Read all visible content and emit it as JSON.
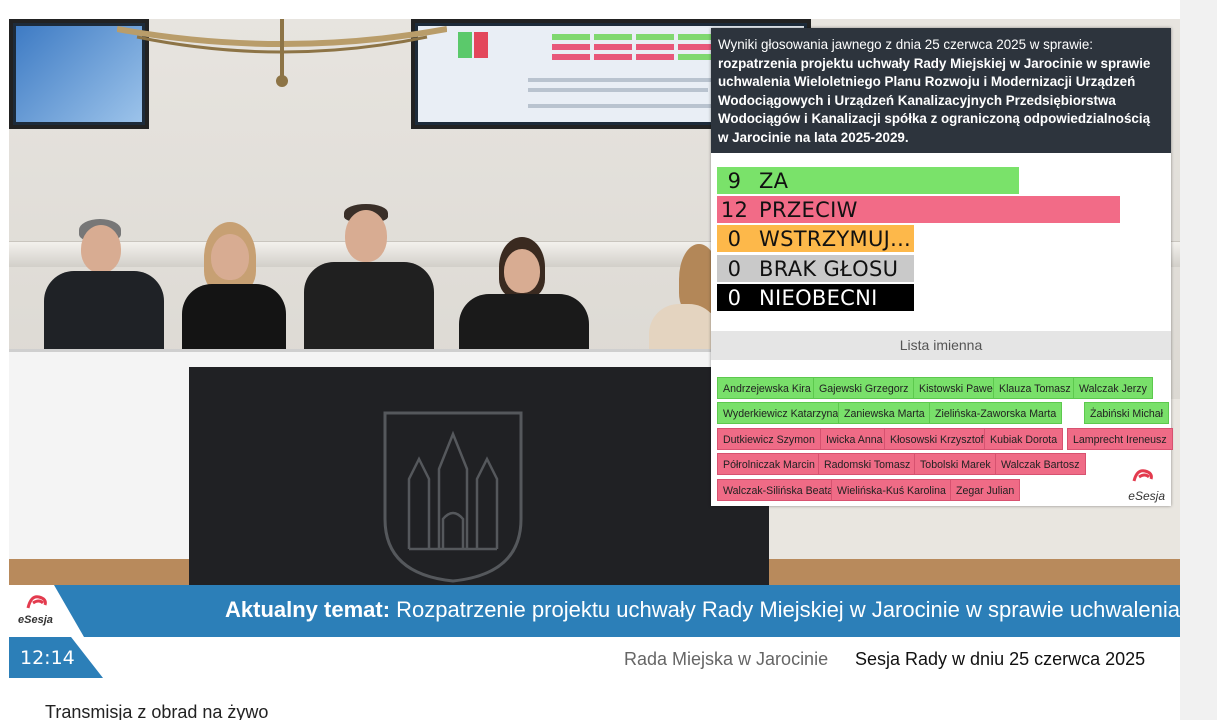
{
  "vote_panel": {
    "intro": "Wyniki głosowania jawnego z dnia 25 czerwca 2025 w sprawie:",
    "subject": "rozpatrzenia projektu uchwały Rady Miejskiej w Jarocinie w sprawie uchwalenia Wieloletniego Planu Rozwoju i Modernizacji Urządzeń Wodociągowych i Urządzeń Kanalizacyjnych Przedsiębiorstwa Wodociągów i Kanalizacji spółka z ograniczoną odpowiedzialnością w Jarocinie na lata 2025-2029.",
    "results": [
      {
        "count": "9",
        "label": "ZA",
        "color": "#7ae26a",
        "share": 0.75
      },
      {
        "count": "12",
        "label": "PRZECIW",
        "color": "#f26b87",
        "share": 1.0
      },
      {
        "count": "0",
        "label": "WSTRZYMUJ...",
        "color": "#fdb84a",
        "share": 0.49
      },
      {
        "count": "0",
        "label": "BRAK GŁOSU",
        "color": "#c9c9c9",
        "share": 0.49
      },
      {
        "count": "0",
        "label": "NIEOBECNI",
        "color": "#000000",
        "share": 0.49
      }
    ],
    "list_header": "Lista imienna",
    "names": [
      {
        "name": "Andrzejewska Kira",
        "vote": "for"
      },
      {
        "name": "Gajewski Grzegorz",
        "vote": "for"
      },
      {
        "name": "Kistowski Paweł",
        "vote": "for"
      },
      {
        "name": "Klauza Tomasz",
        "vote": "for"
      },
      {
        "name": "Walczak Jerzy",
        "vote": "for"
      },
      {
        "name": "Wyderkiewicz Katarzyna",
        "vote": "for"
      },
      {
        "name": "Zaniewska Marta",
        "vote": "for"
      },
      {
        "name": "Zielińska-Zaworska Marta",
        "vote": "for"
      },
      {
        "name": "Żabiński Michał",
        "vote": "for"
      },
      {
        "name": "Dutkiewicz Szymon",
        "vote": "against"
      },
      {
        "name": "Iwicka Anna",
        "vote": "against"
      },
      {
        "name": "Kłosowski Krzysztof",
        "vote": "against"
      },
      {
        "name": "Kubiak Dorota",
        "vote": "against"
      },
      {
        "name": "Lamprecht Ireneusz",
        "vote": "against"
      },
      {
        "name": "Półrolniczak Marcin",
        "vote": "against"
      },
      {
        "name": "Radomski Tomasz",
        "vote": "against"
      },
      {
        "name": "Tobolski Marek",
        "vote": "against"
      },
      {
        "name": "Walczak Bartosz",
        "vote": "against"
      },
      {
        "name": "Walczak-Silińska Beata",
        "vote": "against"
      },
      {
        "name": "Wielińska-Kuś Karolina",
        "vote": "against"
      },
      {
        "name": "Zegar Julian",
        "vote": "against"
      }
    ],
    "logo_text": "eSesja"
  },
  "topic_bar": {
    "key": "Aktualny temat:",
    "text": " Rozpatrzenie projektu uchwały Rady Miejskiej w Jarocinie w sprawie uchwalenia",
    "logo_text": "eSesja"
  },
  "footer": {
    "time": "12:14",
    "council": "Rada Miejska w Jarocinie",
    "session": "Sesja Rady w dniu 25 czerwca 2025"
  },
  "transmission_title": "Transmisja z obrad na żywo",
  "colors": {
    "bar_blue": "#2c7fb8",
    "header_dark": "#2d343d",
    "vote_for": "#79e06a",
    "vote_against": "#ef6b86"
  }
}
